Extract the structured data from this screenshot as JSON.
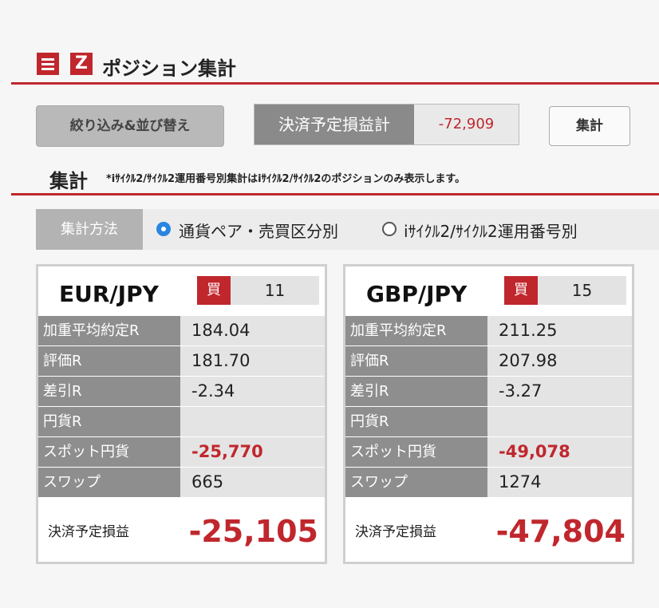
{
  "header": {
    "title": "ポジション集計",
    "menu_icon": "hamburger-menu-icon",
    "brand_icon": "z-logo-icon",
    "brand_letter": "Z",
    "accent_color": "#c0272d"
  },
  "toolbar": {
    "filter_sort_label": "絞り込み&並び替え",
    "summary_label": "決済予定損益計",
    "summary_value": "-72,909",
    "calc_label": "集計"
  },
  "section": {
    "title": "集計",
    "note": "*iｻｲｸﾙ2/ｻｲｸﾙ2運用番号別集計はiｻｲｸﾙ2/ｻｲｸﾙ2のポジションのみ表示します。"
  },
  "method": {
    "label": "集計方法",
    "options": [
      {
        "label": "通貨ペア・売買区分別",
        "selected": true
      },
      {
        "label": "iｻｲｸﾙ2/ｻｲｸﾙ2運用番号別",
        "selected": false
      }
    ]
  },
  "cards": [
    {
      "pair": "EUR/JPY",
      "side": "買",
      "quantity": "11",
      "rows": [
        {
          "label": "加重平均約定R",
          "value": "184.04"
        },
        {
          "label": "評価R",
          "value": "181.70"
        },
        {
          "label": "差引R",
          "value": "-2.34"
        },
        {
          "label": "円貨R",
          "value": ""
        },
        {
          "label": "スポット円貨",
          "value": "-25,770"
        },
        {
          "label": "スワップ",
          "value": "665"
        }
      ],
      "total_label": "決済予定損益",
      "total_value": "-25,105"
    },
    {
      "pair": "GBP/JPY",
      "side": "買",
      "quantity": "15",
      "rows": [
        {
          "label": "加重平均約定R",
          "value": "211.25"
        },
        {
          "label": "評価R",
          "value": "207.98"
        },
        {
          "label": "差引R",
          "value": "-3.27"
        },
        {
          "label": "円貨R",
          "value": ""
        },
        {
          "label": "スポット円貨",
          "value": "-49,078"
        },
        {
          "label": "スワップ",
          "value": "1274"
        }
      ],
      "total_label": "決済予定損益",
      "total_value": "-47,804"
    }
  ]
}
